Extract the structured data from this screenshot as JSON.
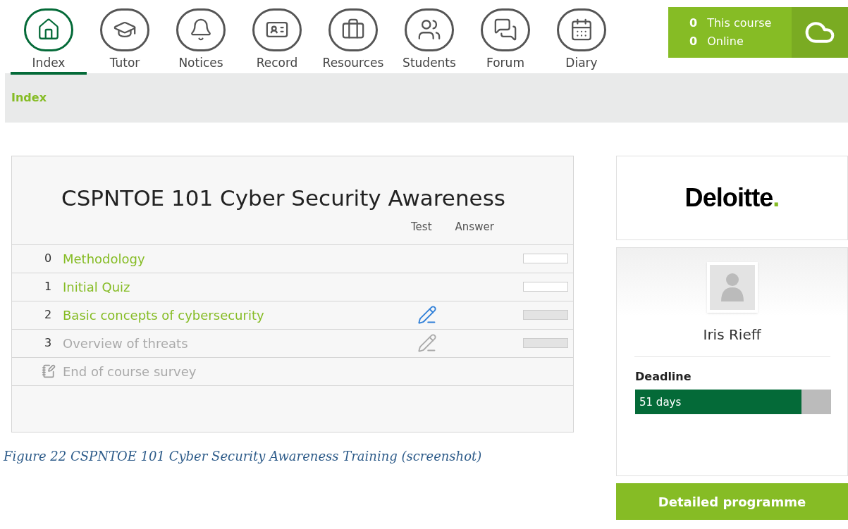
{
  "nav": [
    {
      "label": "Index",
      "selected": true
    },
    {
      "label": "Tutor",
      "selected": false
    },
    {
      "label": "Notices",
      "selected": false
    },
    {
      "label": "Record",
      "selected": false
    },
    {
      "label": "Resources",
      "selected": false
    },
    {
      "label": "Students",
      "selected": false
    },
    {
      "label": "Forum",
      "selected": false
    },
    {
      "label": "Diary",
      "selected": false
    }
  ],
  "stats": [
    {
      "count": "0",
      "label": "This course"
    },
    {
      "count": "0",
      "label": "Online"
    }
  ],
  "breadcrumb": "Index",
  "course": {
    "title": "CSPNTOE 101 Cyber Security Awareness",
    "columns": [
      "Test",
      "Answer"
    ],
    "rows": [
      {
        "kind": "unit",
        "number": "0",
        "title": "Methodology",
        "enabled": true,
        "test": false,
        "bar_active": false
      },
      {
        "kind": "unit",
        "number": "1",
        "title": "Initial Quiz",
        "enabled": true,
        "test": false,
        "bar_active": false
      },
      {
        "kind": "unit",
        "number": "2",
        "title": "Basic concepts of cybersecurity",
        "enabled": true,
        "test": true,
        "bar_active": true
      },
      {
        "kind": "unit",
        "number": "3",
        "title": "Overview of threats",
        "enabled": false,
        "test": true,
        "bar_active": true
      },
      {
        "kind": "survey",
        "title": "End of course survey",
        "enabled": false
      }
    ]
  },
  "caption": "Figure 22 CSPNTOE 101 Cyber Security Awareness Training (screenshot)",
  "logo": {
    "text": "Deloitte",
    "mark": "."
  },
  "profile": {
    "name": "Iris Rieff",
    "deadline_label": "Deadline",
    "deadline": {
      "level": 0.85,
      "reading": "51 days"
    }
  },
  "button": "Detailed programme"
}
